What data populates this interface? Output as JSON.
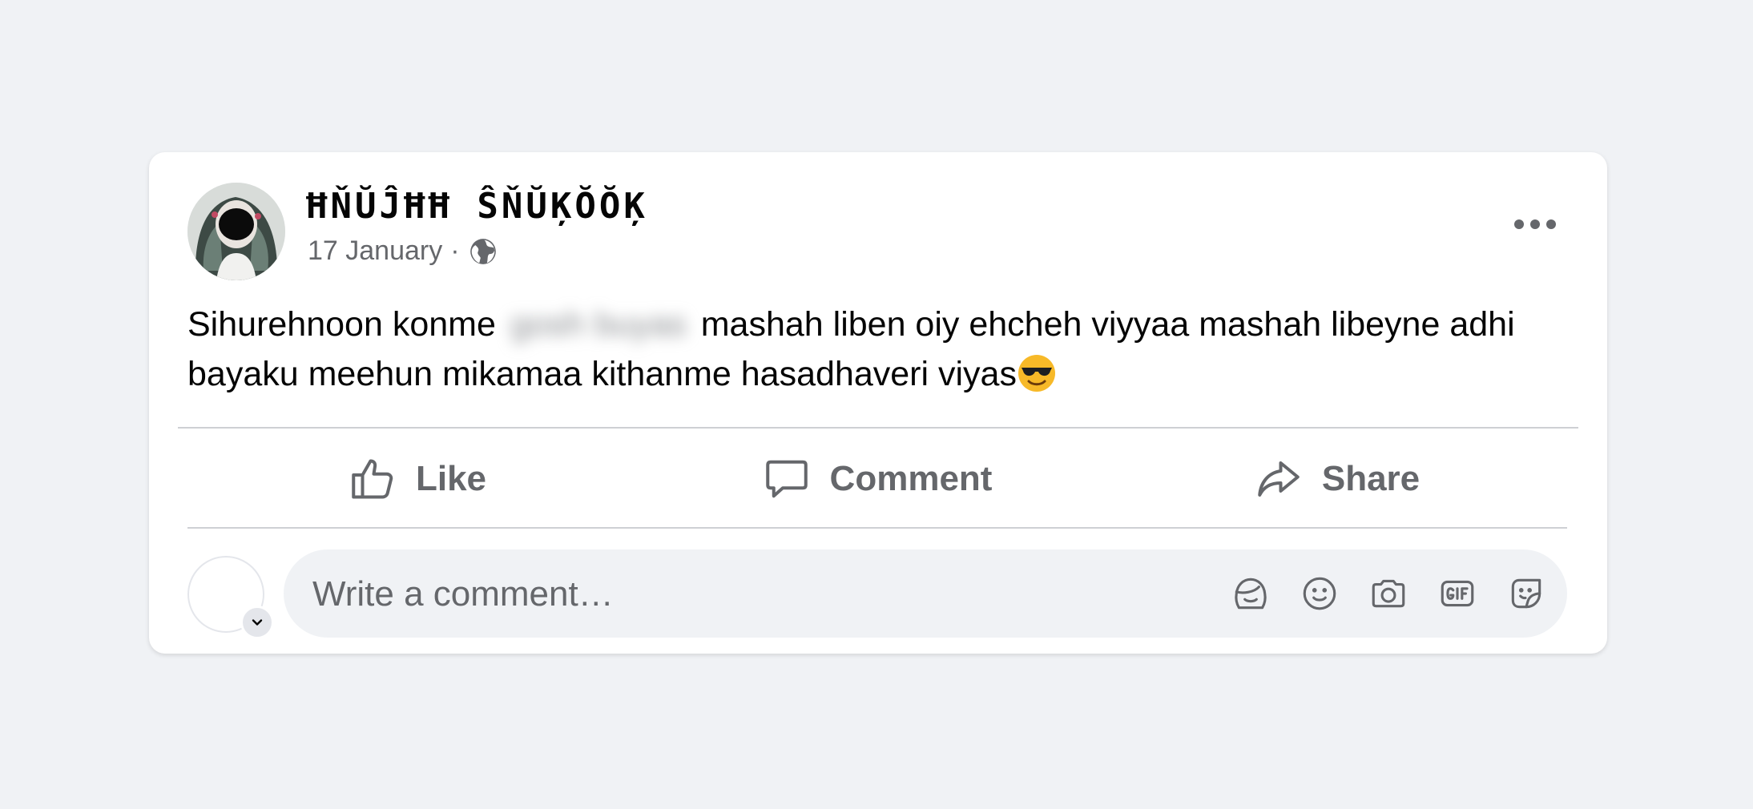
{
  "post": {
    "author_name": "ĦŇŬĴĦĦ ŜŇŬĶŎŎĶ",
    "date": "17 January",
    "meta_separator": "·",
    "audience_icon": "globe-icon",
    "more_icon": "more-horizontal-icon",
    "text_before_blur": "Sihurehnoon konme ",
    "text_blurred": "gosh buyas",
    "text_after_blur": " mashah liben oiy ehcheh viyyaa mashah libeyne adhi bayaku meehun mikamaa  kithanme hasadhaveri viyas",
    "trailing_emoji": "smiling-face-with-sunglasses-emoji"
  },
  "actions": {
    "like_label": "Like",
    "like_icon": "thumbs-up-icon",
    "comment_label": "Comment",
    "comment_icon": "speech-bubble-icon",
    "share_label": "Share",
    "share_icon": "share-arrow-icon"
  },
  "comment_composer": {
    "placeholder": "Write a comment…",
    "value": "",
    "tool_icons": [
      "avatar-sticker-icon",
      "emoji-icon",
      "camera-icon",
      "gif-icon",
      "sticker-icon"
    ]
  },
  "colors": {
    "page_background": "#f0f2f5",
    "card_background": "#ffffff",
    "secondary_text": "#65676b",
    "primary_text": "#050505",
    "divider": "#ced0d4"
  }
}
